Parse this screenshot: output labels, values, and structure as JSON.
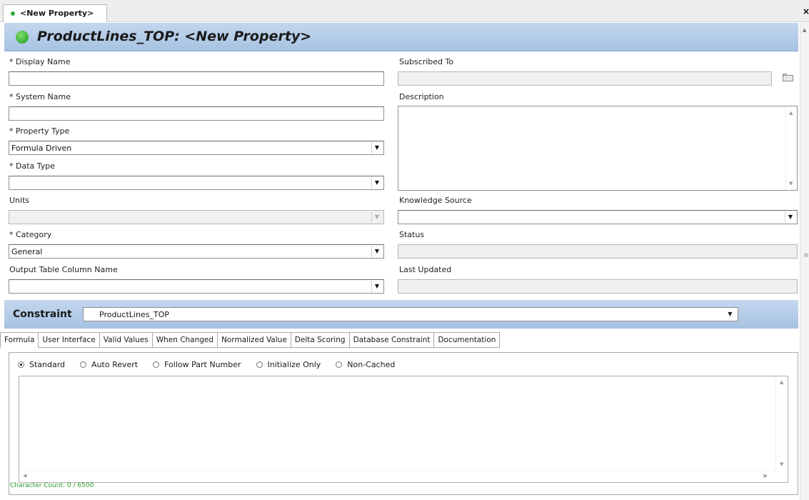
{
  "window": {
    "tab_title": "<New Property>",
    "close_glyph": "×",
    "header_title": "ProductLines_TOP: <New Property>"
  },
  "form": {
    "display_name": {
      "label": "* Display Name",
      "value": ""
    },
    "system_name": {
      "label": "* System Name",
      "value": ""
    },
    "property_type": {
      "label": "* Property Type",
      "value": "Formula Driven"
    },
    "data_type": {
      "label": "* Data Type",
      "value": ""
    },
    "units": {
      "label": "Units",
      "value": ""
    },
    "category": {
      "label": "* Category",
      "value": "General"
    },
    "output_table_column_name": {
      "label": "Output Table Column Name",
      "value": ""
    },
    "subscribed_to": {
      "label": "Subscribed To",
      "value": ""
    },
    "description": {
      "label": "Description",
      "value": ""
    },
    "knowledge_source": {
      "label": "Knowledge Source",
      "value": ""
    },
    "status": {
      "label": "Status",
      "value": ""
    },
    "last_updated": {
      "label": "Last Updated",
      "value": ""
    }
  },
  "constraint": {
    "label": "Constraint",
    "value": "ProductLines_TOP"
  },
  "tabs": [
    {
      "label": "Formula",
      "active": true
    },
    {
      "label": "User Interface",
      "active": false
    },
    {
      "label": "Valid Values",
      "active": false
    },
    {
      "label": "When Changed",
      "active": false
    },
    {
      "label": "Normalized Value",
      "active": false
    },
    {
      "label": "Delta Scoring",
      "active": false
    },
    {
      "label": "Database Constraint",
      "active": false
    },
    {
      "label": "Documentation",
      "active": false
    }
  ],
  "formula": {
    "modes": [
      {
        "label": "Standard",
        "selected": true
      },
      {
        "label": "Auto Revert",
        "selected": false
      },
      {
        "label": "Follow Part Number",
        "selected": false
      },
      {
        "label": "Initialize Only",
        "selected": false
      },
      {
        "label": "Non-Cached",
        "selected": false
      }
    ],
    "editor_value": "",
    "char_count": "Character Count: 0 / 6500"
  },
  "colors": {
    "header_band": "#b5cce8",
    "status_dot": "#3dae33",
    "char_count_text": "#2f9a2f"
  },
  "icons": [
    "status-dot-icon",
    "close-icon",
    "folder-icon",
    "dropdown-arrow-icon",
    "scroll-arrow-icon"
  ]
}
